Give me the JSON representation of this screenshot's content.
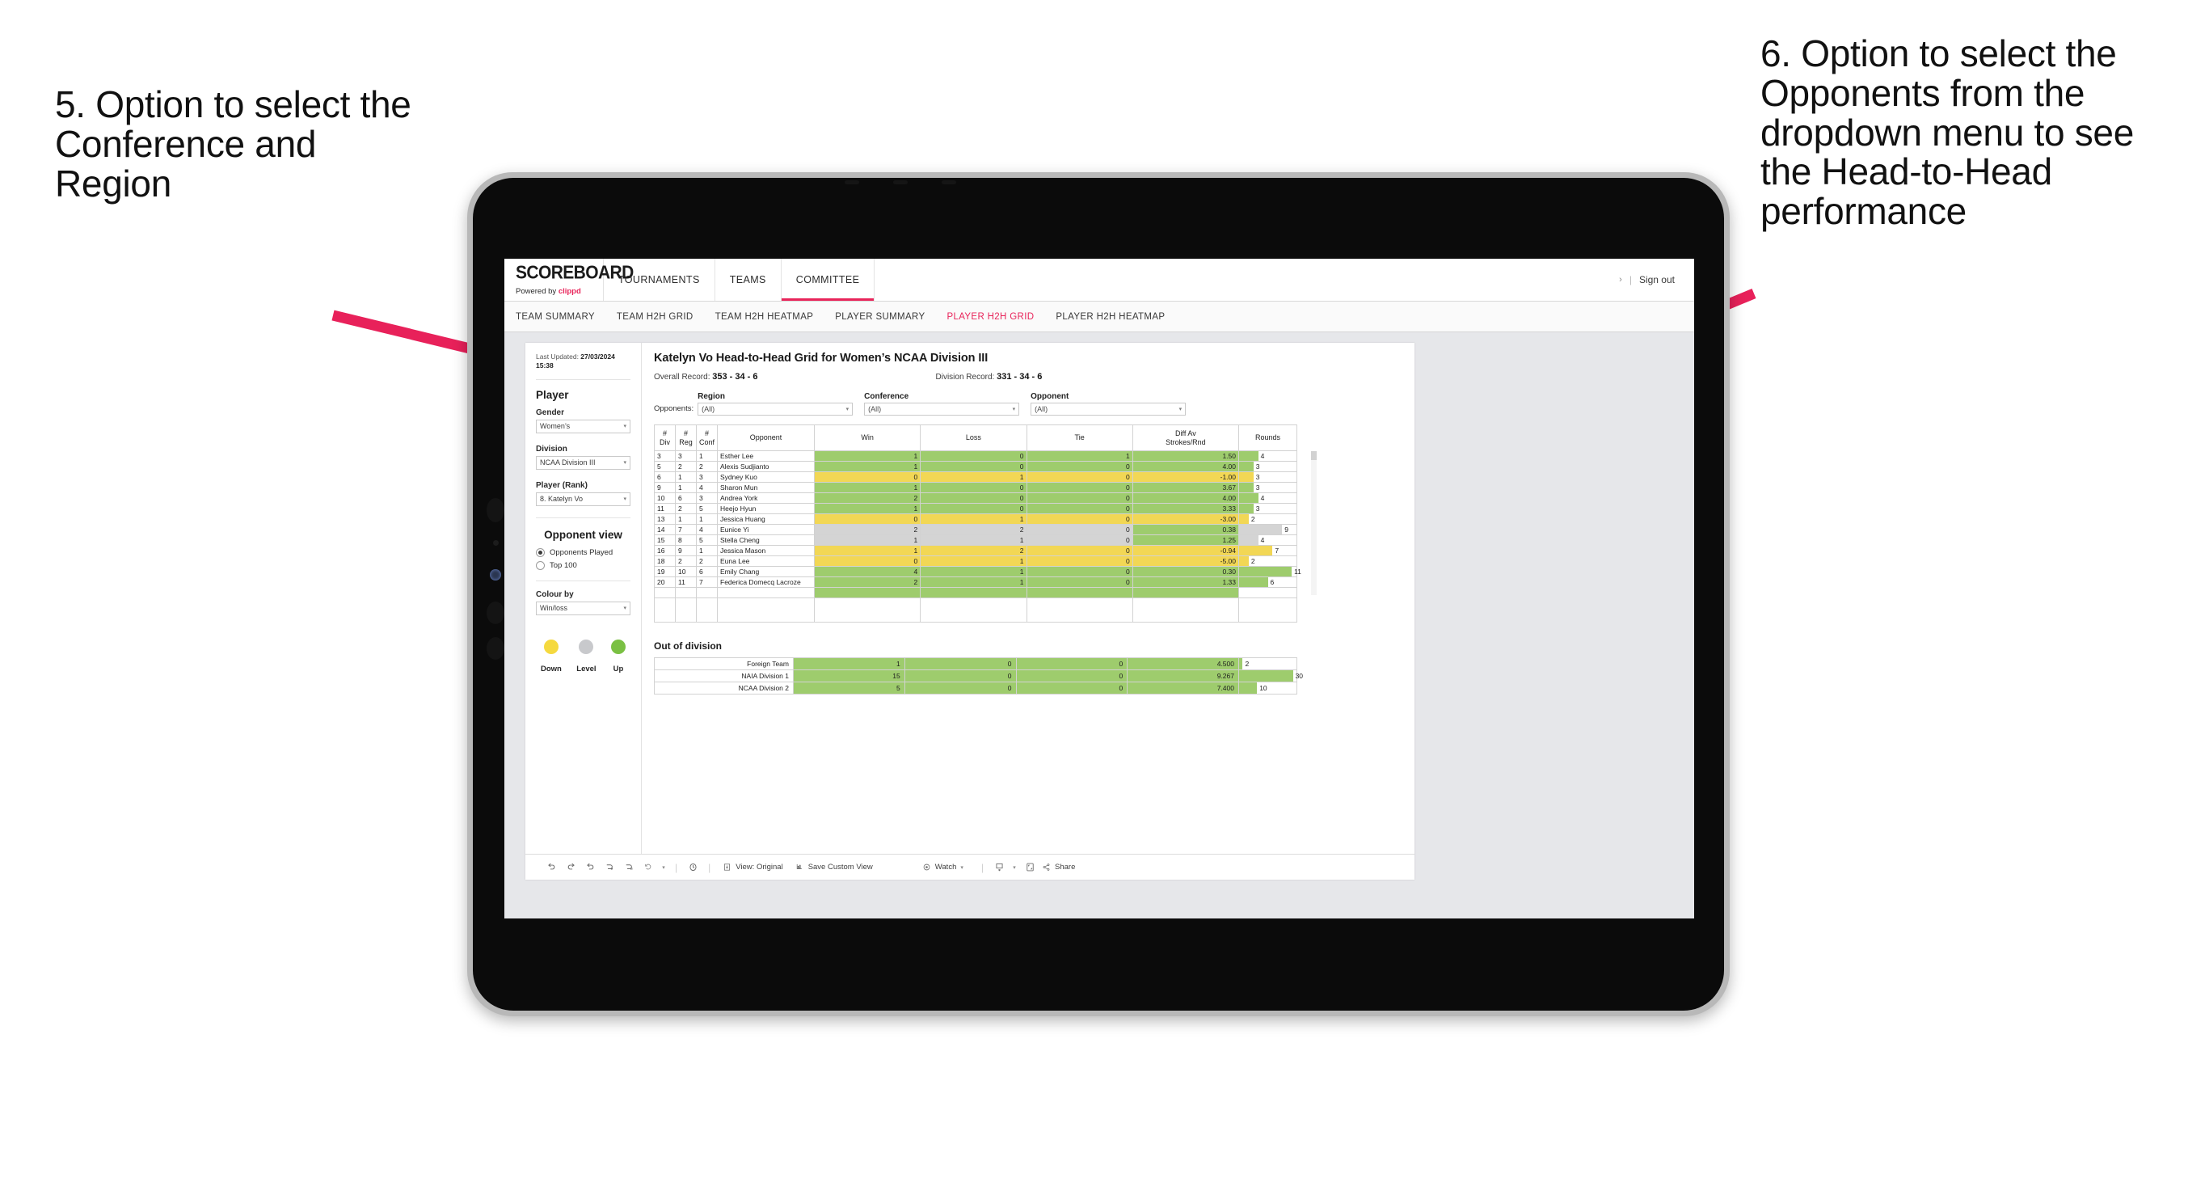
{
  "annotations": {
    "left": "5. Option to select the Conference and Region",
    "right": "6. Option to select the Opponents from the dropdown menu to see the Head-to-Head performance",
    "arrow_color": "#e8215a"
  },
  "topnav": {
    "brand_title": "SCOREBOARD",
    "brand_sub_prefix": "Powered by ",
    "brand_sub_name": "clippd",
    "items": [
      {
        "label": "TOURNAMENTS",
        "active": false
      },
      {
        "label": "TEAMS",
        "active": false
      },
      {
        "label": "COMMITTEE",
        "active": true
      }
    ],
    "chevron": "›",
    "divider": "|",
    "signout": "Sign out"
  },
  "subnav": {
    "items": [
      {
        "label": "TEAM SUMMARY",
        "active": false
      },
      {
        "label": "TEAM H2H GRID",
        "active": false
      },
      {
        "label": "TEAM H2H HEATMAP",
        "active": false
      },
      {
        "label": "PLAYER SUMMARY",
        "active": false
      },
      {
        "label": "PLAYER H2H GRID",
        "active": true
      },
      {
        "label": "PLAYER H2H HEATMAP",
        "active": false
      }
    ]
  },
  "sidebar": {
    "last_updated_label": "Last Updated: ",
    "last_updated_value": "27/03/2024",
    "last_updated_time": "15:38",
    "player_heading": "Player",
    "gender_label": "Gender",
    "gender_value": "Women’s",
    "division_label": "Division",
    "division_value": "NCAA Division III",
    "player_rank_label": "Player (Rank)",
    "player_rank_value": "8. Katelyn Vo",
    "opponent_view_heading": "Opponent view",
    "radio_opponents_played": "Opponents Played",
    "radio_top100": "Top 100",
    "colour_by_label": "Colour by",
    "colour_by_value": "Win/loss",
    "legend": [
      {
        "label": "Down",
        "color": "#f5d93f"
      },
      {
        "label": "Level",
        "color": "#c8c9cc"
      },
      {
        "label": "Up",
        "color": "#7ac043"
      }
    ],
    "caret": "▾"
  },
  "main": {
    "title": "Katelyn Vo Head-to-Head Grid for Women’s NCAA Division III",
    "overall_record_label": "Overall Record: ",
    "overall_record_value": "353 - 34 - 6",
    "division_record_label": "Division Record: ",
    "division_record_value": "331 - 34 - 6",
    "opponents_label": "Opponents:",
    "filters": [
      {
        "caption": "Region",
        "value": "(All)"
      },
      {
        "caption": "Conference",
        "value": "(All)"
      },
      {
        "caption": "Opponent",
        "value": "(All)"
      }
    ],
    "caret": "▾",
    "out_of_division_title": "Out of division"
  },
  "chart_data": {
    "type": "table",
    "title": "Katelyn Vo Head-to-Head Grid for Women’s NCAA Division III",
    "columns": [
      "# Div",
      "# Reg",
      "# Conf",
      "Opponent",
      "Win",
      "Loss",
      "Tie",
      "Diff Av Strokes/Rnd",
      "Rounds"
    ],
    "column_headers_multiline": [
      {
        "l1": "#",
        "l2": "Div"
      },
      {
        "l1": "#",
        "l2": "Reg"
      },
      {
        "l1": "#",
        "l2": "Conf"
      },
      {
        "l1": "Opponent",
        "l2": ""
      },
      {
        "l1": "Win",
        "l2": ""
      },
      {
        "l1": "Loss",
        "l2": ""
      },
      {
        "l1": "Tie",
        "l2": ""
      },
      {
        "l1": "Diff Av",
        "l2": "Strokes/Rnd"
      },
      {
        "l1": "Rounds",
        "l2": ""
      }
    ],
    "colour_by": "Win/loss",
    "colour_scale": {
      "down": "#f2d755",
      "level": "#d4d4d4",
      "up": "#9ecc6d"
    },
    "rounds_max": 12,
    "rows": [
      {
        "div": "3",
        "reg": "3",
        "conf": "1",
        "opponent": "Esther Lee",
        "win": "1",
        "loss": "0",
        "tie": "1",
        "diff": "1.50",
        "rounds": 4,
        "state": "up"
      },
      {
        "div": "5",
        "reg": "2",
        "conf": "2",
        "opponent": "Alexis Sudjianto",
        "win": "1",
        "loss": "0",
        "tie": "0",
        "diff": "4.00",
        "rounds": 3,
        "state": "up"
      },
      {
        "div": "6",
        "reg": "1",
        "conf": "3",
        "opponent": "Sydney Kuo",
        "win": "0",
        "loss": "1",
        "tie": "0",
        "diff": "-1.00",
        "rounds": 3,
        "state": "down"
      },
      {
        "div": "9",
        "reg": "1",
        "conf": "4",
        "opponent": "Sharon Mun",
        "win": "1",
        "loss": "0",
        "tie": "0",
        "diff": "3.67",
        "rounds": 3,
        "state": "up"
      },
      {
        "div": "10",
        "reg": "6",
        "conf": "3",
        "opponent": "Andrea York",
        "win": "2",
        "loss": "0",
        "tie": "0",
        "diff": "4.00",
        "rounds": 4,
        "state": "up"
      },
      {
        "div": "11",
        "reg": "2",
        "conf": "5",
        "opponent": "Heejo Hyun",
        "win": "1",
        "loss": "0",
        "tie": "0",
        "diff": "3.33",
        "rounds": 3,
        "state": "up"
      },
      {
        "div": "13",
        "reg": "1",
        "conf": "1",
        "opponent": "Jessica Huang",
        "win": "0",
        "loss": "1",
        "tie": "0",
        "diff": "-3.00",
        "rounds": 2,
        "state": "down"
      },
      {
        "div": "14",
        "reg": "7",
        "conf": "4",
        "opponent": "Eunice Yi",
        "win": "2",
        "loss": "2",
        "tie": "0",
        "diff": "0.38",
        "rounds": 9,
        "state": "level"
      },
      {
        "div": "15",
        "reg": "8",
        "conf": "5",
        "opponent": "Stella Cheng",
        "win": "1",
        "loss": "1",
        "tie": "0",
        "diff": "1.25",
        "rounds": 4,
        "state": "level"
      },
      {
        "div": "16",
        "reg": "9",
        "conf": "1",
        "opponent": "Jessica Mason",
        "win": "1",
        "loss": "2",
        "tie": "0",
        "diff": "-0.94",
        "rounds": 7,
        "state": "down"
      },
      {
        "div": "18",
        "reg": "2",
        "conf": "2",
        "opponent": "Euna Lee",
        "win": "0",
        "loss": "1",
        "tie": "0",
        "diff": "-5.00",
        "rounds": 2,
        "state": "down"
      },
      {
        "div": "19",
        "reg": "10",
        "conf": "6",
        "opponent": "Emily Chang",
        "win": "4",
        "loss": "1",
        "tie": "0",
        "diff": "0.30",
        "rounds": 11,
        "state": "up"
      },
      {
        "div": "20",
        "reg": "11",
        "conf": "7",
        "opponent": "Federica Domecq Lacroze",
        "win": "2",
        "loss": "1",
        "tie": "0",
        "diff": "1.33",
        "rounds": 6,
        "state": "up"
      }
    ],
    "out_of_division": {
      "rounds_max": 32,
      "rows": [
        {
          "name": "Foreign Team",
          "win": "1",
          "loss": "0",
          "tie": "0",
          "diff": "4.500",
          "rounds": 2,
          "state": "up"
        },
        {
          "name": "NAIA Division 1",
          "win": "15",
          "loss": "0",
          "tie": "0",
          "diff": "9.267",
          "rounds": 30,
          "state": "up"
        },
        {
          "name": "NCAA Division 2",
          "win": "5",
          "loss": "0",
          "tie": "0",
          "diff": "7.400",
          "rounds": 10,
          "state": "up"
        }
      ]
    }
  },
  "toolbar": {
    "icons": [
      "undo-icon",
      "redo-icon",
      "revert-icon",
      "refresh-icon",
      "pause-icon",
      "undo-arrow-icon"
    ],
    "view_label": "View: Original",
    "save_custom_view_label": "Save Custom View",
    "watch_label": "Watch",
    "share_label": "Share",
    "separator": "|",
    "caret": "▾"
  }
}
